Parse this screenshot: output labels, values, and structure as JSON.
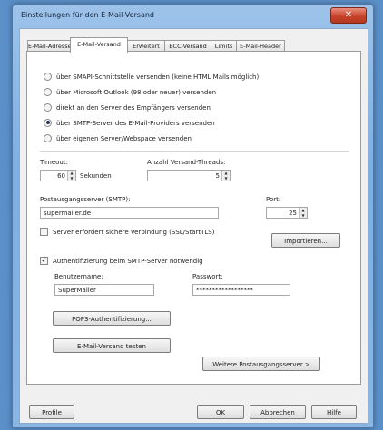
{
  "window": {
    "title": "Einstellungen für den E-Mail-Versand",
    "close_glyph": "✕"
  },
  "tabs": [
    {
      "label": "E-Mail-Adressen",
      "active": false
    },
    {
      "label": "E-Mail-Versand",
      "active": true
    },
    {
      "label": "Erweitert",
      "active": false
    },
    {
      "label": "BCC-Versand",
      "active": false
    },
    {
      "label": "Limits",
      "active": false
    },
    {
      "label": "E-Mail-Header",
      "active": false
    }
  ],
  "send_methods": [
    {
      "label": "über SMAPI-Schnittstelle versenden (keine HTML Mails möglich)",
      "selected": false
    },
    {
      "label": "über Microsoft Outlook (98 oder neuer) versenden",
      "selected": false
    },
    {
      "label": "direkt an den Server des Empfängers versenden",
      "selected": false
    },
    {
      "label": "über SMTP-Server des E-Mail-Providers versenden",
      "selected": true
    },
    {
      "label": "über eigenen Server/Webspace versenden",
      "selected": false
    }
  ],
  "timeout": {
    "label": "Timeout:",
    "value": "60",
    "unit": "Sekunden"
  },
  "threads": {
    "label": "Anzahl Versand-Threads:",
    "value": "5"
  },
  "smtp": {
    "label": "Postausgangsserver (SMTP):",
    "value": "supermailer.de"
  },
  "port": {
    "label": "Port:",
    "value": "25"
  },
  "secure_connection": {
    "label": "Server erfordert sichere Verbindung (SSL/StartTLS)",
    "checked": false
  },
  "import_button": "Importieren...",
  "smtp_auth": {
    "label": "Authentifizierung beim SMTP-Server notwendig",
    "checked": true
  },
  "username": {
    "label": "Benutzername:",
    "value": "SuperMailer"
  },
  "password": {
    "label": "Passwort:",
    "value": "******************"
  },
  "pop3_button": "POP3-Authentifizierung...",
  "test_button": "E-Mail-Versand testen",
  "more_servers_button": "Weitere Postausgangsserver >",
  "footer": {
    "profile": "Profile",
    "ok": "OK",
    "cancel": "Abbrechen",
    "help": "Hilfe"
  },
  "check_glyph": "✓",
  "spin_up": "▲",
  "spin_down": "▼"
}
